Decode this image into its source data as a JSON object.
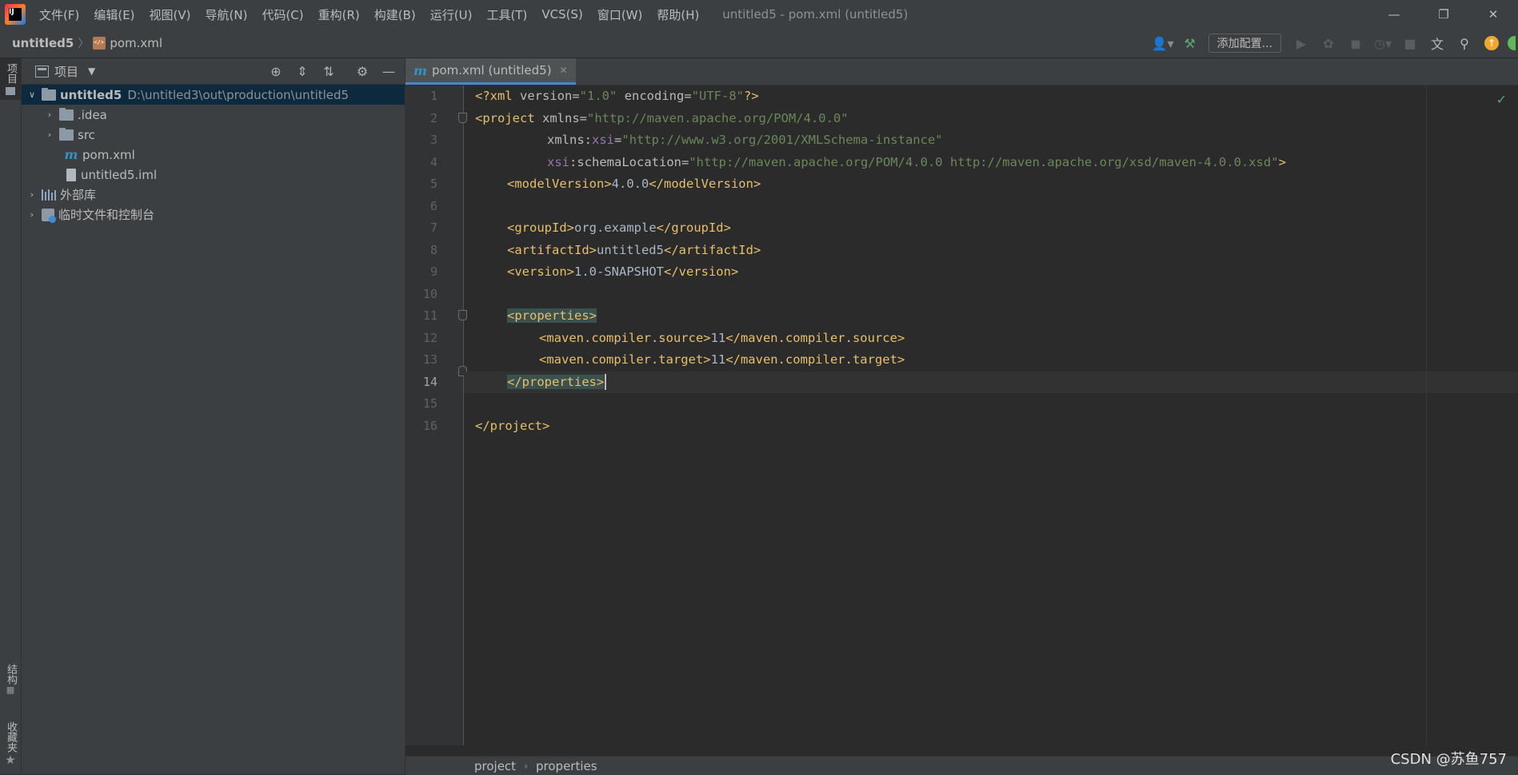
{
  "menubar": {
    "items": [
      "文件(F)",
      "编辑(E)",
      "视图(V)",
      "导航(N)",
      "代码(C)",
      "重构(R)",
      "构建(B)",
      "运行(U)",
      "工具(T)",
      "VCS(S)",
      "窗口(W)",
      "帮助(H)"
    ],
    "window_title": "untitled5 - pom.xml (untitled5)"
  },
  "navbar": {
    "project": "untitled5",
    "file": "pom.xml",
    "add_config_label": "添加配置..."
  },
  "left_stripe": {
    "project": "项目",
    "structure": "结构",
    "favorites": "收藏夹"
  },
  "project_panel": {
    "title": "项目",
    "tree": [
      {
        "label": "untitled5",
        "hint": "D:\\untitled3\\out\\production\\untitled5"
      },
      {
        "label": ".idea"
      },
      {
        "label": "src"
      },
      {
        "label": "pom.xml"
      },
      {
        "label": "untitled5.iml"
      },
      {
        "label": "外部库"
      },
      {
        "label": "临时文件和控制台"
      }
    ]
  },
  "editor": {
    "tab_label": "pom.xml (untitled5)",
    "current_line": 14,
    "line_numbers": [
      "1",
      "2",
      "3",
      "4",
      "5",
      "6",
      "7",
      "8",
      "9",
      "10",
      "11",
      "12",
      "13",
      "14",
      "15",
      "16"
    ]
  },
  "code_tokens": {
    "l1": [
      "<?xml ",
      "version",
      "=",
      "\"1.0\"",
      " ",
      "encoding",
      "=",
      "\"UTF-8\"",
      "?>"
    ],
    "l2": [
      "<project ",
      "xmlns",
      "=",
      "\"http://maven.apache.org/POM/4.0.0\""
    ],
    "l3": [
      "xmlns",
      ":",
      "xsi",
      "=",
      "\"http://www.w3.org/2001/XMLSchema-instance\""
    ],
    "l4": [
      "xsi",
      ":",
      "schemaLocation",
      "=",
      "\"http://maven.apache.org/POM/4.0.0 http://maven.apache.org/xsd/maven-4.0.0.xsd\"",
      ">"
    ],
    "l5": [
      "<modelVersion>",
      "4.0.0",
      "</modelVersion>"
    ],
    "l7": [
      "<groupId>",
      "org.example",
      "</groupId>"
    ],
    "l8": [
      "<artifactId>",
      "untitled5",
      "</artifactId>"
    ],
    "l9": [
      "<version>",
      "1.0-SNAPSHOT",
      "</version>"
    ],
    "l11": [
      "<properties>"
    ],
    "l12": [
      "<maven.compiler.source>",
      "11",
      "</maven.compiler.source>"
    ],
    "l13": [
      "<maven.compiler.target>",
      "11",
      "</maven.compiler.target>"
    ],
    "l14": [
      "</properties>"
    ],
    "l16": [
      "</project>"
    ]
  },
  "bottom_breadcrumb": [
    "project",
    "properties"
  ],
  "watermark": "CSDN @苏鱼757",
  "colors": {
    "tag": "#e8bf6a",
    "attribute_value": "#6a8759",
    "namespace": "#9876aa",
    "text": "#a9b7c6",
    "accent": "#4a88c7",
    "inspection_ok": "#59a869"
  }
}
